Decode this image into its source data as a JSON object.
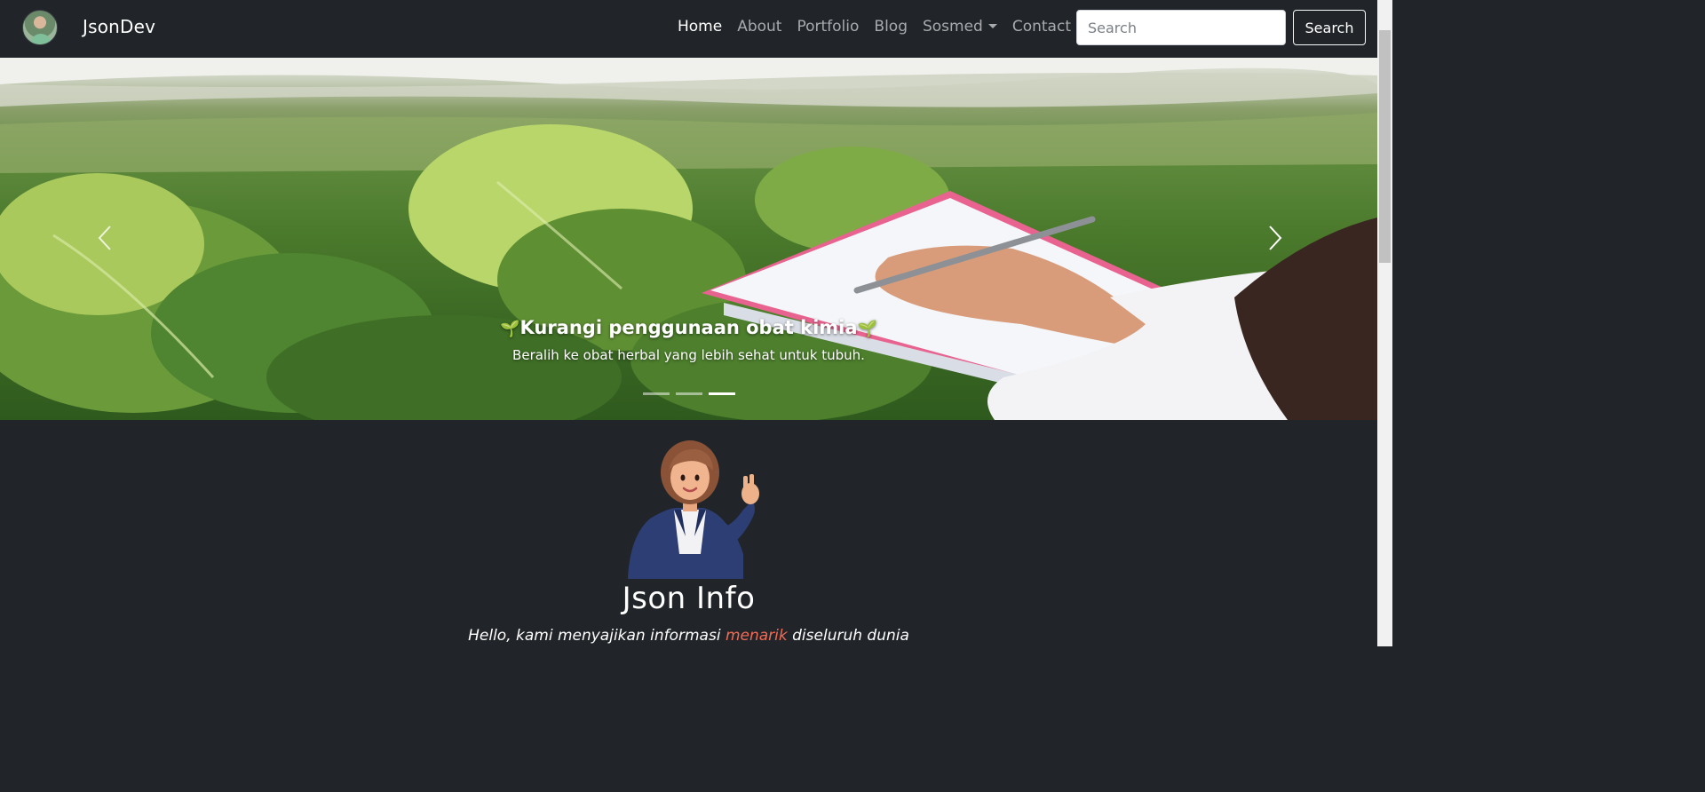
{
  "navbar": {
    "brand": "JsonDev",
    "links": [
      {
        "label": "Home",
        "active": true
      },
      {
        "label": "About",
        "active": false
      },
      {
        "label": "Portfolio",
        "active": false
      },
      {
        "label": "Blog",
        "active": false
      },
      {
        "label": "Sosmed",
        "active": false,
        "dropdown": true
      },
      {
        "label": "Contact",
        "active": false
      }
    ],
    "search": {
      "placeholder": "Search",
      "button_label": "Search"
    }
  },
  "carousel": {
    "caption_title": "Kurangi penggunaan obat kimia",
    "caption_emoji": "🌱",
    "caption_text": "Beralih ke obat herbal yang lebih sehat untuk tubuh.",
    "slide_count": 3,
    "active_slide": 3
  },
  "info": {
    "title": "Json Info",
    "subtitle_before": "Hello, kami menyajikan informasi ",
    "subtitle_accent": "menarik",
    "subtitle_after": " diseluruh dunia"
  },
  "colors": {
    "background": "#212529",
    "accent": "#f26b55",
    "nav_inactive": "#a8aaad"
  },
  "icons": [
    "avatar",
    "chevron-left-icon",
    "chevron-right-icon",
    "caret-down-icon",
    "sprout-icon"
  ]
}
